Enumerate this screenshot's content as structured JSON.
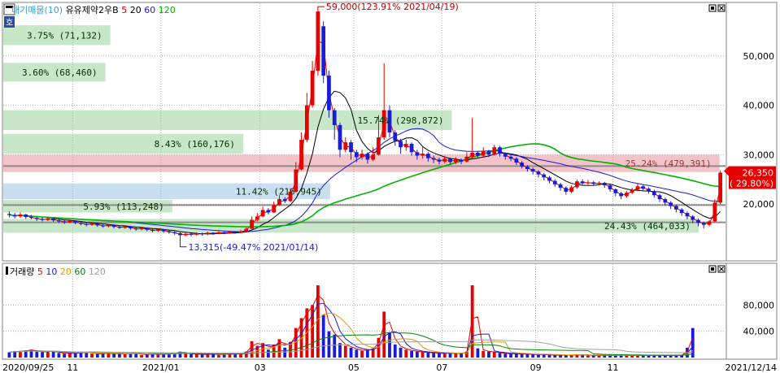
{
  "panels": {
    "price": {
      "legend": [
        {
          "text": "대기매물(10)",
          "color": "#3aa0d8"
        },
        {
          "text": "유유제약2우B",
          "color": "#000000"
        },
        {
          "text": "5",
          "color": "#e60000"
        },
        {
          "text": "20",
          "color": "#000000"
        },
        {
          "text": "60",
          "color": "#1b1bd6"
        },
        {
          "text": "120",
          "color": "#00b300"
        }
      ],
      "marker_label": "호"
    },
    "volume": {
      "legend": [
        {
          "text": "거래량",
          "color": "#000000"
        },
        {
          "text": "5",
          "color": "#e60000"
        },
        {
          "text": "10",
          "color": "#1b1bd6"
        },
        {
          "text": "20",
          "color": "#e89900"
        },
        {
          "text": "60",
          "color": "#008800"
        },
        {
          "text": "120",
          "color": "#a0a0a0"
        }
      ]
    }
  },
  "colors": {
    "up": "#e60000",
    "down": "#1b1bd6",
    "border": "#808080"
  },
  "chart_data": [
    {
      "type": "candlestick",
      "y_ticks": [
        20000,
        30000,
        40000,
        50000
      ],
      "y_tick_labels": [
        "20,000",
        "30,000",
        "40,000",
        "50,000"
      ],
      "x_labels": [
        "2020/09/25",
        "11",
        "2021/01",
        "03",
        "05",
        "07",
        "09",
        "11",
        "2021/12/14"
      ],
      "ylim": [
        9000,
        60000
      ],
      "price_series": [
        {
          "name": "5",
          "color": "#e60000"
        },
        {
          "name": "20",
          "color": "#000000"
        },
        {
          "name": "60",
          "color": "#1b1bd6"
        },
        {
          "name": "120",
          "color": "#00b300"
        }
      ],
      "volume_profile": [
        {
          "label": "24.43% (464,033)",
          "price_low": 14200,
          "price_high": 17000,
          "ratio": 1.0,
          "highlight": "green"
        },
        {
          "label": "5.93% (113,248)",
          "price_low": 18300,
          "price_high": 20800,
          "ratio": 0.243,
          "highlight": "green"
        },
        {
          "label": "11.42% (216,945)",
          "price_low": 21000,
          "price_high": 24200,
          "ratio": 0.47,
          "highlight": "blue"
        },
        {
          "label": "25.24% (479,391)",
          "price_low": 26500,
          "price_high": 30000,
          "ratio": 1.03,
          "highlight": "red"
        },
        {
          "label": "8.43% (160,176)",
          "price_low": 30200,
          "price_high": 34200,
          "ratio": 0.345,
          "highlight": "green"
        },
        {
          "label": "15.74% (298,872)",
          "price_low": 35000,
          "price_high": 39000,
          "ratio": 0.645,
          "highlight": "green"
        },
        {
          "label": "3.60% (68,460)",
          "price_low": 44800,
          "price_high": 48600,
          "ratio": 0.147,
          "highlight": "green"
        },
        {
          "label": "3.75% (71,132)",
          "price_low": 52200,
          "price_high": 56200,
          "ratio": 0.154,
          "highlight": "green"
        }
      ],
      "annotations": {
        "high": "59,000(123.91% 2021/04/19)",
        "low": "13,315(-49.47% 2021/01/14)",
        "high_value": 59000,
        "low_value": 13315
      },
      "current_price": {
        "value": 26350,
        "label": "26,350",
        "change": "( 29.80%)"
      },
      "ohlc": [
        [
          18000,
          17800,
          18500,
          17300
        ],
        [
          17800,
          17500,
          18200,
          17100
        ],
        [
          17500,
          17900,
          18300,
          17200
        ],
        [
          17900,
          17400,
          18000,
          17000
        ],
        [
          17400,
          17200,
          17800,
          16900
        ],
        [
          17200,
          17000,
          17500,
          16600
        ],
        [
          17000,
          16800,
          17300,
          16500
        ],
        [
          16800,
          17100,
          17400,
          16600
        ],
        [
          17100,
          16700,
          17200,
          16400
        ],
        [
          16700,
          16500,
          16900,
          16200
        ],
        [
          16500,
          16300,
          16800,
          16000
        ],
        [
          16300,
          16600,
          16900,
          16100
        ],
        [
          16600,
          16200,
          16700,
          15900
        ],
        [
          16200,
          16000,
          16500,
          15700
        ],
        [
          16000,
          15800,
          16200,
          15500
        ],
        [
          15800,
          16100,
          16400,
          15600
        ],
        [
          16100,
          15700,
          16200,
          15400
        ],
        [
          15700,
          15500,
          15900,
          15200
        ],
        [
          15500,
          15800,
          16000,
          15300
        ],
        [
          15800,
          15400,
          15900,
          15100
        ],
        [
          15400,
          15200,
          15600,
          15000
        ],
        [
          15200,
          15500,
          15700,
          15000
        ],
        [
          15500,
          15100,
          15600,
          14800
        ],
        [
          15100,
          14900,
          15300,
          14600
        ],
        [
          14900,
          15200,
          15400,
          14700
        ],
        [
          15200,
          14800,
          15300,
          14500
        ],
        [
          14800,
          14600,
          15000,
          14300
        ],
        [
          14600,
          14900,
          15100,
          14400
        ],
        [
          14900,
          14500,
          15000,
          14200
        ],
        [
          14500,
          14300,
          14700,
          14000
        ],
        [
          14300,
          14100,
          14500,
          13800
        ],
        [
          14100,
          13700,
          14300,
          13315
        ],
        [
          13700,
          14000,
          14200,
          13500
        ],
        [
          14000,
          13800,
          14100,
          13500
        ],
        [
          13800,
          14100,
          14300,
          13600
        ],
        [
          14100,
          13900,
          14200,
          13600
        ],
        [
          13900,
          14200,
          14400,
          13700
        ],
        [
          14200,
          14000,
          14300,
          13800
        ],
        [
          14000,
          14300,
          14500,
          13900
        ],
        [
          14300,
          14100,
          14400,
          13900
        ],
        [
          14100,
          14400,
          14600,
          14000
        ],
        [
          14400,
          14200,
          14500,
          14000
        ],
        [
          14200,
          14500,
          14800,
          14100
        ],
        [
          14500,
          15000,
          15300,
          14400
        ],
        [
          15000,
          16800,
          17500,
          14900
        ],
        [
          16800,
          17500,
          18200,
          16500
        ],
        [
          17500,
          18800,
          19500,
          17300
        ],
        [
          18800,
          18300,
          19200,
          17900
        ],
        [
          18300,
          19800,
          20500,
          18200
        ],
        [
          19800,
          21000,
          21800,
          19600
        ],
        [
          21000,
          20600,
          21400,
          20200
        ],
        [
          20600,
          22500,
          23200,
          20400
        ],
        [
          22500,
          27000,
          28500,
          22300
        ],
        [
          27000,
          33000,
          34500,
          26800
        ],
        [
          33000,
          40000,
          42500,
          32500
        ],
        [
          40000,
          47000,
          49000,
          39500
        ],
        [
          47000,
          59000,
          59000,
          46000
        ],
        [
          56000,
          46000,
          57000,
          44500
        ],
        [
          46000,
          39000,
          47000,
          37500
        ],
        [
          39000,
          36000,
          39500,
          33000
        ],
        [
          36000,
          31000,
          36500,
          29500
        ],
        [
          31000,
          32500,
          33500,
          30500
        ],
        [
          32500,
          30500,
          33000,
          29000
        ],
        [
          30500,
          29500,
          31000,
          28500
        ],
        [
          29500,
          30200,
          31000,
          29000
        ],
        [
          30200,
          29000,
          30500,
          28200
        ],
        [
          29000,
          30000,
          31500,
          28700
        ],
        [
          30000,
          33500,
          38000,
          29800
        ],
        [
          33500,
          39000,
          48500,
          33000
        ],
        [
          39000,
          34500,
          40000,
          33500
        ],
        [
          34500,
          32800,
          35000,
          31800
        ],
        [
          32800,
          31500,
          33200,
          30200
        ],
        [
          31500,
          32200,
          33000,
          30800
        ],
        [
          32200,
          30500,
          32500,
          29800
        ],
        [
          30500,
          29800,
          31000,
          29000
        ],
        [
          29800,
          30200,
          31500,
          29200
        ],
        [
          30200,
          29300,
          30500,
          28600
        ],
        [
          29300,
          29000,
          29800,
          28300
        ],
        [
          29000,
          28600,
          29400,
          28000
        ],
        [
          28600,
          29200,
          29800,
          28200
        ],
        [
          29200,
          28500,
          29400,
          28000
        ],
        [
          28500,
          29000,
          29500,
          28100
        ],
        [
          29000,
          28600,
          29200,
          28100
        ],
        [
          28600,
          29600,
          30500,
          28400
        ],
        [
          29600,
          30400,
          37500,
          29200
        ],
        [
          30400,
          29800,
          30800,
          29200
        ],
        [
          29800,
          30800,
          31500,
          29400
        ],
        [
          30800,
          30000,
          31000,
          29500
        ],
        [
          30000,
          31500,
          32000,
          29800
        ],
        [
          31500,
          30200,
          31800,
          29600
        ],
        [
          30200,
          29600,
          30500,
          29000
        ],
        [
          29600,
          29200,
          29900,
          28700
        ],
        [
          29200,
          28400,
          29500,
          27900
        ],
        [
          28400,
          27600,
          28700,
          27200
        ],
        [
          27600,
          27100,
          27900,
          26600
        ],
        [
          27100,
          26600,
          27400,
          26000
        ],
        [
          26600,
          26000,
          26900,
          25400
        ],
        [
          26000,
          25400,
          26300,
          24800
        ],
        [
          25400,
          24700,
          25700,
          24200
        ],
        [
          24700,
          24000,
          25000,
          23500
        ],
        [
          24000,
          23300,
          24300,
          22700
        ],
        [
          23300,
          22500,
          23600,
          21900
        ],
        [
          22500,
          23400,
          23800,
          22200
        ],
        [
          23400,
          24600,
          25000,
          23100
        ],
        [
          24600,
          24200,
          25000,
          23800
        ],
        [
          24200,
          24400,
          24900,
          23900
        ],
        [
          24400,
          24100,
          24700,
          23800
        ],
        [
          24100,
          24300,
          24600,
          23800
        ],
        [
          24300,
          23800,
          24500,
          23300
        ],
        [
          23800,
          23000,
          24000,
          22500
        ],
        [
          23000,
          22200,
          23200,
          21600
        ],
        [
          22200,
          21600,
          22500,
          21000
        ],
        [
          21600,
          22300,
          22700,
          21300
        ],
        [
          22300,
          22900,
          23300,
          22000
        ],
        [
          22900,
          23600,
          24100,
          22600
        ],
        [
          23600,
          23100,
          23900,
          22700
        ],
        [
          23100,
          22600,
          23400,
          22100
        ],
        [
          22600,
          21800,
          22900,
          21300
        ],
        [
          21800,
          21000,
          22100,
          20400
        ],
        [
          21000,
          20300,
          21300,
          19700
        ],
        [
          20300,
          19600,
          20600,
          19000
        ],
        [
          19600,
          18900,
          19900,
          18300
        ],
        [
          18900,
          18200,
          19200,
          17600
        ],
        [
          18200,
          17500,
          18500,
          16900
        ],
        [
          17500,
          16800,
          17800,
          16200
        ],
        [
          16800,
          16200,
          17100,
          15500
        ],
        [
          16200,
          15800,
          16400,
          15100
        ],
        [
          15800,
          16500,
          16800,
          15500
        ],
        [
          16500,
          20300,
          21000,
          16300
        ],
        [
          20300,
          26350,
          26800,
          20000
        ]
      ],
      "volume": [
        8000,
        10000,
        9000,
        11000,
        12000,
        9000,
        8000,
        10000,
        9500,
        7000,
        6000,
        6500,
        7000,
        8000,
        9000,
        6000,
        5000,
        7000,
        6500,
        5500,
        6000,
        5000,
        6500,
        7000,
        4000,
        5000,
        6000,
        4500,
        5500,
        6000,
        7000,
        9000,
        6000,
        5000,
        5500,
        4500,
        5000,
        6000,
        4000,
        5000,
        6500,
        5000,
        7000,
        9000,
        25000,
        18000,
        22000,
        12000,
        20000,
        28000,
        15000,
        24000,
        45000,
        60000,
        75000,
        80000,
        110000,
        65000,
        40000,
        35000,
        22000,
        18000,
        15000,
        12000,
        10000,
        12000,
        14000,
        30000,
        70000,
        38000,
        20000,
        15000,
        12000,
        10000,
        9000,
        8000,
        7500,
        7000,
        6500,
        6000,
        7000,
        6000,
        6500,
        9000,
        110000,
        14000,
        10000,
        9000,
        8000,
        7000,
        6000,
        5500,
        6000,
        5000,
        5500,
        4500,
        5000,
        4500,
        4000,
        3500,
        4000,
        3500,
        4000,
        4500,
        4000,
        3500,
        3000,
        3500,
        4000,
        3000,
        3500,
        4000,
        3500,
        3000,
        3500,
        4000,
        3000,
        3500,
        4000,
        3000,
        3500,
        3000,
        4000,
        15000,
        45000
      ],
      "volume_ylim": [
        0,
        120000
      ],
      "volume_y_ticks": [
        40000,
        80000
      ],
      "volume_y_tick_labels": [
        "40,000",
        "80,000"
      ]
    }
  ]
}
